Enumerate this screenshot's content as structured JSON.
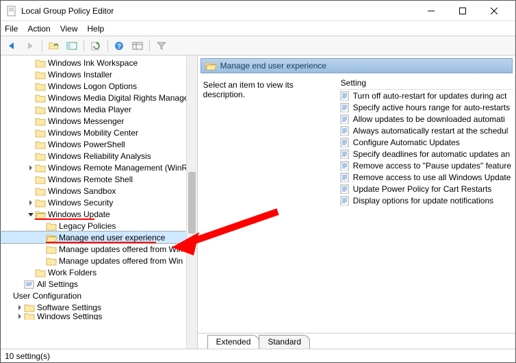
{
  "window": {
    "title": "Local Group Policy Editor"
  },
  "menu": {
    "file": "File",
    "action": "Action",
    "view": "View",
    "help": "Help"
  },
  "tree": {
    "items": [
      {
        "indent": 2,
        "label": "Windows Ink Workspace"
      },
      {
        "indent": 2,
        "label": "Windows Installer"
      },
      {
        "indent": 2,
        "label": "Windows Logon Options"
      },
      {
        "indent": 2,
        "label": "Windows Media Digital Rights Manage"
      },
      {
        "indent": 2,
        "label": "Windows Media Player"
      },
      {
        "indent": 2,
        "label": "Windows Messenger"
      },
      {
        "indent": 2,
        "label": "Windows Mobility Center"
      },
      {
        "indent": 2,
        "label": "Windows PowerShell"
      },
      {
        "indent": 2,
        "label": "Windows Reliability Analysis"
      },
      {
        "indent": 2,
        "label": "Windows Remote Management (WinR",
        "exp": ">"
      },
      {
        "indent": 2,
        "label": "Windows Remote Shell"
      },
      {
        "indent": 2,
        "label": "Windows Sandbox"
      },
      {
        "indent": 2,
        "label": "Windows Security",
        "exp": ">"
      },
      {
        "indent": 2,
        "label": "Windows Update",
        "exp": "v",
        "underline": true
      },
      {
        "indent": 3,
        "label": "Legacy Policies"
      },
      {
        "indent": 3,
        "label": "Manage end user experience",
        "selected": true,
        "underline": true
      },
      {
        "indent": 3,
        "label": "Manage updates offered from Win"
      },
      {
        "indent": 3,
        "label": "Manage updates offered from Win"
      },
      {
        "indent": 2,
        "label": "Work Folders"
      },
      {
        "indent": 1,
        "label": "All Settings",
        "icontype": "settings"
      },
      {
        "indent": 0,
        "label": "User Configuration",
        "bare": true
      },
      {
        "indent": 1,
        "label": "Software Settings",
        "exp": ">"
      },
      {
        "indent": 1,
        "label": "Windows Settings",
        "exp": ">",
        "cut": true
      }
    ]
  },
  "right": {
    "header": "Manage end user experience",
    "description": "Select an item to view its description.",
    "columnHeader": "Setting",
    "items": [
      "Turn off auto-restart for updates during act",
      "Specify active hours range for auto-restarts",
      "Allow updates to be downloaded automati",
      "Always automatically restart at the schedul",
      "Configure Automatic Updates",
      "Specify deadlines for automatic updates an",
      "Remove access to \"Pause updates\" feature",
      "Remove access to use all Windows Update",
      "Update Power Policy for Cart Restarts",
      "Display options for update notifications"
    ]
  },
  "tabs": {
    "extended": "Extended",
    "standard": "Standard"
  },
  "status": {
    "text": "10 setting(s)"
  }
}
